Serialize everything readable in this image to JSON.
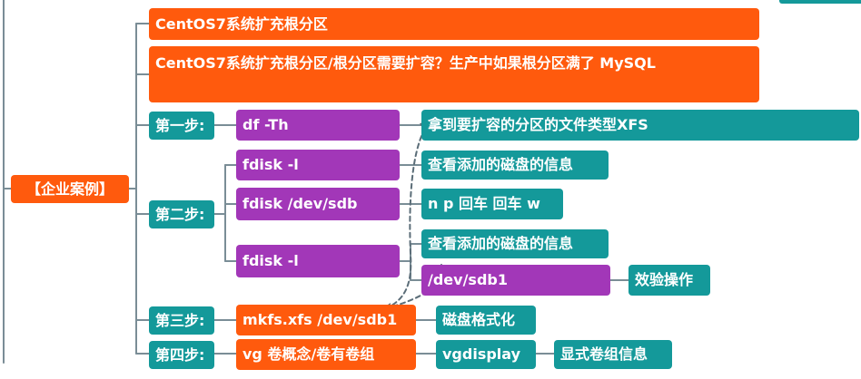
{
  "root": {
    "label": "【企业案例】"
  },
  "titles": [
    "CentOS7系统扩充根分区",
    "CentOS7系统扩充根分区/根分区需要扩容？生产中如果根分区满了 MySQL"
  ],
  "steps": {
    "step1": {
      "label": "第一步:",
      "command": "df -Th",
      "note": "拿到要扩容的分区的文件类型XFS"
    },
    "step2": {
      "label": "第二步:",
      "cmd1": "fdisk -l",
      "note1": "查看添加的磁盘的信息",
      "cmd2": "fdisk /dev/sdb",
      "note2": "n p 回车 回车 w",
      "cmd3": "fdisk -l",
      "note3": "查看添加的磁盘的信息",
      "device": "/dev/sdb1",
      "verify": "效验操作"
    },
    "step3": {
      "label": "第三步:",
      "command": "mkfs.xfs /dev/sdb1",
      "note": "磁盘格式化"
    },
    "step4": {
      "label": "第四步:",
      "command": "vg 卷概念/卷有卷组",
      "sub": "vgdisplay",
      "note": "显式卷组信息"
    }
  },
  "colors": {
    "orange": "#ff5a0d",
    "teal": "#14999a",
    "purple": "#a237b8",
    "connector": "#7a8d96"
  }
}
